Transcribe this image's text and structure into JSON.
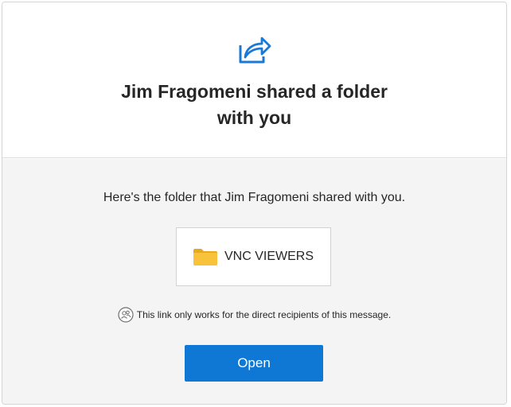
{
  "header": {
    "icon": "share-arrow-icon",
    "title_line1": "Jim Fragomeni shared a folder",
    "title_line2": "with you"
  },
  "body": {
    "description": "Here's the folder that Jim Fragomeni shared with you.",
    "folder": {
      "icon": "folder-icon",
      "name": "VNC VIEWERS"
    },
    "notice": {
      "icon": "people-icon",
      "text": "This link only works for the direct recipients of this message."
    },
    "open_label": "Open"
  },
  "colors": {
    "accent": "#0f78d4",
    "folder": "#f8c23a",
    "body_bg": "#f4f4f4"
  }
}
